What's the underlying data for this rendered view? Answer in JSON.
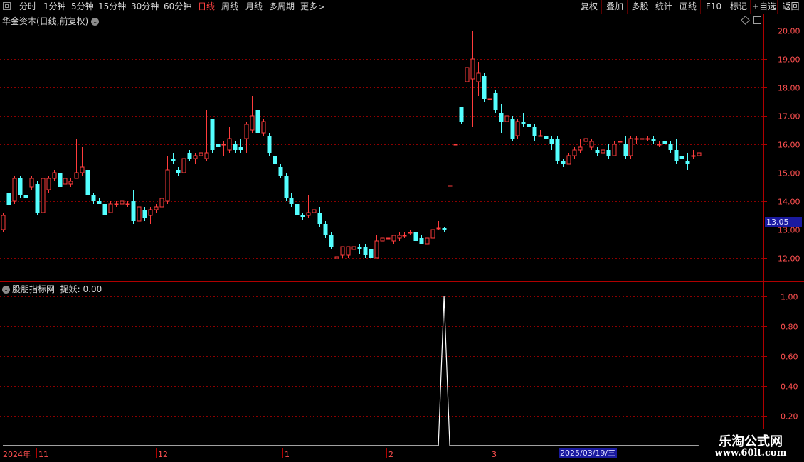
{
  "toolbar": {
    "periods": [
      "分时",
      "1分钟",
      "5分钟",
      "15分钟",
      "30分钟",
      "60分钟",
      "日线",
      "周线",
      "月线",
      "多周期",
      "更多"
    ],
    "active_period": "日线",
    "right_buttons": [
      "复权",
      "叠加",
      "多股",
      "统计",
      "画线",
      "F10",
      "+自选",
      "返回"
    ]
  },
  "main_panel": {
    "title": "华金资本(日线,前复权)",
    "current_price": "13.05",
    "axis_labels": [
      "20.00",
      "19.00",
      "18.00",
      "17.00",
      "16.00",
      "15.00",
      "14.00",
      "13.00",
      "12.00"
    ]
  },
  "indicator_panel": {
    "title": "股朋指标网",
    "label": "捉妖: 0.00",
    "axis_labels": [
      "1.00",
      "0.80",
      "0.60",
      "0.40",
      "0.20"
    ]
  },
  "time_axis": {
    "labels": [
      "2024年",
      "11",
      "12",
      "1",
      "2",
      "3"
    ],
    "cursor_date": "2025/03/19/三"
  },
  "watermark": {
    "line1": "乐淘公式网",
    "line2": "www.60lt.com"
  },
  "colors": {
    "up": "#ff3c3c",
    "down": "#54ffff",
    "grid": "#8b0000",
    "border": "#b00000"
  },
  "chart_data": [
    {
      "type": "candlestick",
      "title": "华金资本(日线,前复权)",
      "ylim": [
        11.5,
        20.3
      ],
      "x": [
        "2024-10-22",
        "2024-10-23",
        "2024-10-24",
        "2024-10-25",
        "2024-10-28",
        "2024-10-29",
        "2024-10-30",
        "2024-10-31",
        "2024-11-01",
        "2024-11-04",
        "2024-11-05",
        "2024-11-06",
        "2024-11-07",
        "2024-11-08",
        "2024-11-11",
        "2024-11-12",
        "2024-11-13",
        "2024-11-14",
        "2024-11-15",
        "2024-11-18",
        "2024-11-19",
        "2024-11-20",
        "2024-11-21",
        "2024-11-22",
        "2024-11-25",
        "2024-11-26",
        "2024-11-27",
        "2024-11-28",
        "2024-11-29",
        "2024-12-02",
        "2024-12-03",
        "2024-12-04",
        "2024-12-05",
        "2024-12-06",
        "2024-12-09",
        "2024-12-10",
        "2024-12-11",
        "2024-12-12",
        "2024-12-13",
        "2024-12-16",
        "2024-12-17",
        "2024-12-18",
        "2024-12-19",
        "2024-12-20",
        "2024-12-23",
        "2024-12-24",
        "2024-12-25",
        "2024-12-26",
        "2024-12-27",
        "2024-12-30",
        "2024-12-31",
        "2025-01-02",
        "2025-01-03",
        "2025-01-06",
        "2025-01-07",
        "2025-01-08",
        "2025-01-09",
        "2025-01-10",
        "2025-01-13",
        "2025-01-14",
        "2025-01-15",
        "2025-01-16",
        "2025-01-17",
        "2025-01-20",
        "2025-01-21",
        "2025-01-22",
        "2025-01-23",
        "2025-01-24",
        "2025-01-27",
        "2025-02-05",
        "2025-02-06",
        "2025-02-07",
        "2025-02-10",
        "2025-02-11",
        "2025-02-12",
        "2025-02-13",
        "2025-02-14",
        "2025-02-17",
        "2025-02-18",
        "2025-02-19",
        "2025-02-20",
        "2025-02-21",
        "2025-02-24",
        "2025-02-25",
        "2025-02-26",
        "2025-02-27",
        "2025-02-28",
        "2025-03-03",
        "2025-03-04",
        "2025-03-05",
        "2025-03-06",
        "2025-03-07",
        "2025-03-10",
        "2025-03-11",
        "2025-03-12",
        "2025-03-13",
        "2025-03-14",
        "2025-03-17",
        "2025-03-18",
        "2025-03-19",
        "2025-03-20",
        "2025-03-21",
        "2025-03-24",
        "2025-03-25",
        "2025-03-26",
        "2025-03-27",
        "2025-03-28",
        "2025-03-31",
        "2025-04-01",
        "2025-04-02",
        "2025-04-03",
        "2025-04-07",
        "2025-04-08",
        "2025-04-09",
        "2025-04-10",
        "2025-04-11",
        "2025-04-14",
        "2025-04-15",
        "2025-04-16",
        "2025-04-17",
        "2025-04-18",
        "2025-04-21",
        "2025-04-22",
        "2025-04-23",
        "2025-04-24",
        "2025-04-25",
        "2025-04-28",
        "2025-04-29",
        "2025-04-30",
        "2025-05-06",
        "2025-05-07",
        "2025-05-08",
        "2025-05-09",
        "2025-05-12",
        "2025-05-13"
      ],
      "ohlc": [
        [
          13.0,
          13.6,
          12.9,
          13.5
        ],
        [
          14.3,
          14.4,
          13.8,
          13.85
        ],
        [
          14.0,
          14.9,
          13.9,
          14.8
        ],
        [
          14.8,
          14.9,
          14.1,
          14.2
        ],
        [
          14.2,
          14.3,
          13.9,
          14.1
        ],
        [
          14.5,
          14.9,
          14.4,
          14.8
        ],
        [
          14.6,
          14.7,
          13.5,
          13.6
        ],
        [
          13.6,
          14.9,
          13.6,
          14.8
        ],
        [
          14.4,
          14.9,
          14.3,
          14.8
        ],
        [
          14.8,
          15.1,
          14.7,
          15.0
        ],
        [
          15.0,
          15.2,
          14.5,
          14.5
        ],
        [
          14.6,
          14.8,
          14.5,
          14.8
        ],
        [
          14.6,
          14.8,
          14.5,
          14.7
        ],
        [
          14.8,
          16.2,
          14.8,
          15.0
        ],
        [
          15.0,
          15.9,
          14.9,
          15.2
        ],
        [
          15.1,
          15.2,
          14.1,
          14.2
        ],
        [
          14.2,
          14.3,
          13.9,
          14.0
        ],
        [
          14.0,
          14.1,
          13.9,
          13.9
        ],
        [
          13.9,
          14.0,
          13.4,
          13.5
        ],
        [
          13.6,
          14.0,
          13.6,
          13.9
        ],
        [
          13.9,
          14.0,
          13.8,
          13.9
        ],
        [
          13.9,
          14.1,
          13.85,
          14.0
        ],
        [
          13.9,
          14.0,
          13.8,
          13.9
        ],
        [
          14.0,
          14.4,
          13.2,
          13.3
        ],
        [
          13.3,
          13.9,
          13.2,
          13.8
        ],
        [
          13.7,
          13.8,
          13.3,
          13.4
        ],
        [
          13.5,
          13.8,
          13.2,
          13.7
        ],
        [
          13.7,
          13.9,
          13.6,
          13.8
        ],
        [
          13.8,
          14.2,
          13.7,
          14.1
        ],
        [
          14.0,
          15.6,
          13.9,
          15.1
        ],
        [
          15.5,
          15.7,
          15.3,
          15.4
        ],
        [
          15.1,
          15.2,
          14.9,
          15.0
        ],
        [
          15.0,
          15.6,
          15.0,
          15.5
        ],
        [
          15.7,
          15.8,
          15.4,
          15.5
        ],
        [
          15.5,
          15.7,
          15.3,
          15.6
        ],
        [
          15.6,
          16.2,
          15.5,
          15.7
        ],
        [
          15.5,
          17.2,
          15.4,
          15.7
        ],
        [
          16.9,
          16.9,
          15.7,
          15.8
        ],
        [
          16.0,
          16.7,
          15.7,
          15.9
        ],
        [
          16.0,
          16.1,
          15.6,
          16.0
        ],
        [
          15.8,
          16.6,
          15.7,
          16.2
        ],
        [
          16.0,
          16.1,
          15.7,
          15.8
        ],
        [
          15.9,
          16.2,
          15.7,
          15.8
        ],
        [
          16.2,
          16.8,
          15.7,
          16.7
        ],
        [
          16.5,
          17.7,
          16.4,
          17.0
        ],
        [
          17.2,
          17.7,
          16.3,
          16.4
        ],
        [
          16.4,
          16.9,
          16.3,
          16.8
        ],
        [
          16.3,
          16.4,
          15.6,
          15.7
        ],
        [
          15.6,
          15.7,
          15.2,
          15.3
        ],
        [
          15.2,
          15.3,
          14.8,
          14.9
        ],
        [
          14.9,
          15.0,
          14.0,
          14.1
        ],
        [
          14.1,
          14.3,
          13.8,
          13.9
        ],
        [
          13.9,
          14.0,
          13.4,
          13.5
        ],
        [
          13.5,
          13.6,
          13.35,
          13.45
        ],
        [
          13.5,
          14.2,
          13.4,
          13.6
        ],
        [
          13.6,
          13.8,
          13.5,
          13.7
        ],
        [
          13.6,
          13.8,
          13.1,
          13.2
        ],
        [
          13.2,
          13.3,
          12.7,
          12.8
        ],
        [
          12.8,
          12.9,
          12.3,
          12.4
        ],
        [
          12.0,
          12.4,
          11.8,
          12.05
        ],
        [
          12.1,
          12.4,
          12.0,
          12.4
        ],
        [
          12.1,
          12.4,
          12.0,
          12.4
        ],
        [
          12.3,
          12.5,
          12.15,
          12.4
        ],
        [
          12.4,
          12.5,
          12.15,
          12.3
        ],
        [
          12.4,
          12.5,
          12.0,
          12.1
        ],
        [
          12.3,
          12.4,
          11.6,
          12.0
        ],
        [
          12.0,
          12.8,
          12.0,
          12.6
        ],
        [
          12.6,
          12.7,
          12.6,
          12.7
        ],
        [
          12.7,
          12.8,
          12.6,
          12.7
        ],
        [
          12.6,
          12.8,
          12.5,
          12.8
        ],
        [
          12.7,
          12.9,
          12.6,
          12.8
        ],
        [
          12.8,
          12.9,
          12.7,
          12.8
        ],
        [
          12.9,
          13.0,
          12.8,
          12.9
        ],
        [
          12.9,
          13.0,
          12.6,
          12.6
        ],
        [
          12.7,
          12.8,
          12.5,
          12.5
        ],
        [
          12.5,
          12.7,
          12.5,
          12.7
        ],
        [
          12.7,
          13.1,
          12.6,
          13.0
        ],
        [
          13.05,
          13.3,
          13.0,
          13.05
        ],
        [
          13.05,
          13.1,
          12.9,
          13.0
        ],
        [
          14.55,
          14.6,
          14.5,
          14.55
        ],
        [
          16.0,
          16.0,
          16.0,
          16.0
        ],
        [
          17.3,
          17.3,
          16.7,
          16.8
        ],
        [
          18.2,
          19.6,
          17.6,
          18.7
        ],
        [
          18.3,
          20.0,
          16.6,
          19.0
        ],
        [
          18.2,
          18.9,
          17.7,
          18.5
        ],
        [
          18.4,
          18.5,
          17.5,
          17.6
        ],
        [
          17.6,
          18.0,
          17.0,
          17.6
        ],
        [
          17.8,
          17.9,
          17.1,
          17.2
        ],
        [
          17.1,
          17.4,
          16.4,
          16.8
        ],
        [
          16.8,
          17.2,
          16.6,
          17.0
        ],
        [
          16.9,
          17.0,
          16.1,
          16.2
        ],
        [
          16.3,
          16.9,
          16.2,
          16.8
        ],
        [
          16.8,
          17.1,
          16.6,
          16.7
        ],
        [
          16.7,
          16.8,
          16.4,
          16.6
        ],
        [
          16.6,
          16.7,
          16.1,
          16.3
        ],
        [
          16.3,
          16.5,
          16.3,
          16.3
        ],
        [
          16.3,
          16.5,
          16.2,
          16.2
        ],
        [
          16.2,
          16.3,
          15.8,
          16.0
        ],
        [
          16.2,
          16.3,
          15.3,
          15.4
        ],
        [
          15.4,
          15.5,
          15.2,
          15.3
        ],
        [
          15.3,
          15.7,
          15.3,
          15.6
        ],
        [
          15.6,
          15.9,
          15.5,
          15.8
        ],
        [
          15.8,
          16.2,
          15.7,
          15.9
        ],
        [
          16.1,
          16.3,
          16.0,
          16.2
        ],
        [
          15.9,
          16.2,
          15.8,
          16.1
        ],
        [
          15.8,
          15.9,
          15.6,
          15.7
        ],
        [
          15.7,
          15.8,
          15.6,
          15.8
        ],
        [
          15.8,
          16.0,
          15.5,
          15.6
        ],
        [
          15.6,
          16.1,
          15.6,
          16.0
        ],
        [
          16.1,
          16.2,
          16.0,
          16.1
        ],
        [
          16.0,
          16.3,
          15.5,
          15.6
        ],
        [
          15.6,
          16.3,
          15.5,
          16.2
        ],
        [
          16.2,
          16.3,
          16.0,
          16.2
        ],
        [
          16.2,
          16.4,
          16.1,
          16.2
        ],
        [
          16.2,
          16.3,
          16.1,
          16.2
        ],
        [
          16.2,
          16.3,
          16.0,
          16.1
        ],
        [
          16.0,
          16.1,
          15.9,
          16.0
        ],
        [
          16.1,
          16.5,
          16.0,
          16.0
        ],
        [
          16.0,
          16.1,
          15.7,
          15.8
        ],
        [
          15.8,
          16.2,
          15.3,
          15.4
        ],
        [
          15.6,
          15.8,
          15.2,
          15.5
        ],
        [
          15.4,
          15.7,
          15.1,
          15.3
        ],
        [
          15.6,
          15.8,
          15.5,
          15.6
        ],
        [
          15.6,
          16.3,
          15.5,
          15.7
        ]
      ]
    },
    {
      "type": "line",
      "title": "股朋指标网",
      "ylim": [
        0,
        1.1
      ],
      "series": [
        {
          "name": "捉妖",
          "peak_index": 78,
          "peak_value": 1.0,
          "baseline": 0.0,
          "last_value": 0.0
        }
      ]
    }
  ]
}
